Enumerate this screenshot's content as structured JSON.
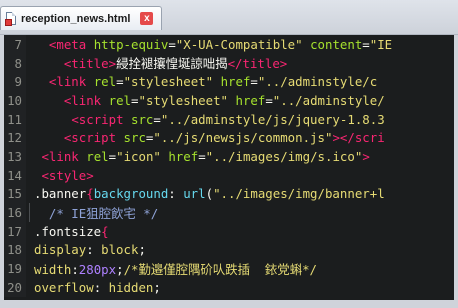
{
  "tab": {
    "filename": "reception_news.html",
    "close_symbol": "x"
  },
  "lines": [
    {
      "n": "7",
      "segments": [
        {
          "cls": "txt",
          "t": "  "
        },
        {
          "cls": "tag",
          "t": "<meta"
        },
        {
          "cls": "txt",
          "t": " "
        },
        {
          "cls": "attr",
          "t": "http-equiv"
        },
        {
          "cls": "txt",
          "t": "="
        },
        {
          "cls": "str",
          "t": "\"X-UA-Compatible\""
        },
        {
          "cls": "txt",
          "t": " "
        },
        {
          "cls": "attr",
          "t": "content"
        },
        {
          "cls": "txt",
          "t": "="
        },
        {
          "cls": "str",
          "t": "\"IE"
        }
      ]
    },
    {
      "n": "8",
      "segments": [
        {
          "cls": "txt",
          "t": "    "
        },
        {
          "cls": "tag",
          "t": "<title>"
        },
        {
          "cls": "txt",
          "t": "綅拴褪攘惶埏諒咄揭"
        },
        {
          "cls": "tag",
          "t": "</title>"
        }
      ]
    },
    {
      "n": "9",
      "segments": [
        {
          "cls": "txt",
          "t": "  "
        },
        {
          "cls": "tag",
          "t": "<link"
        },
        {
          "cls": "txt",
          "t": " "
        },
        {
          "cls": "attr",
          "t": "rel"
        },
        {
          "cls": "txt",
          "t": "="
        },
        {
          "cls": "str",
          "t": "\"stylesheet\""
        },
        {
          "cls": "txt",
          "t": " "
        },
        {
          "cls": "attr",
          "t": "href"
        },
        {
          "cls": "txt",
          "t": "="
        },
        {
          "cls": "str",
          "t": "\"../adminstyle/c"
        }
      ]
    },
    {
      "n": "10",
      "segments": [
        {
          "cls": "txt",
          "t": "    "
        },
        {
          "cls": "tag",
          "t": "<link"
        },
        {
          "cls": "txt",
          "t": " "
        },
        {
          "cls": "attr",
          "t": "rel"
        },
        {
          "cls": "txt",
          "t": "="
        },
        {
          "cls": "str",
          "t": "\"stylesheet\""
        },
        {
          "cls": "txt",
          "t": " "
        },
        {
          "cls": "attr",
          "t": "href"
        },
        {
          "cls": "txt",
          "t": "="
        },
        {
          "cls": "str",
          "t": "\"../adminstyle/"
        }
      ]
    },
    {
      "n": "11",
      "segments": [
        {
          "cls": "txt",
          "t": "     "
        },
        {
          "cls": "tag",
          "t": "<script"
        },
        {
          "cls": "txt",
          "t": " "
        },
        {
          "cls": "attr",
          "t": "src"
        },
        {
          "cls": "txt",
          "t": "="
        },
        {
          "cls": "str",
          "t": "\"../adminstyle/js/jquery-1.8.3"
        }
      ]
    },
    {
      "n": "12",
      "segments": [
        {
          "cls": "txt",
          "t": "    "
        },
        {
          "cls": "tag",
          "t": "<script"
        },
        {
          "cls": "txt",
          "t": " "
        },
        {
          "cls": "attr",
          "t": "src"
        },
        {
          "cls": "txt",
          "t": "="
        },
        {
          "cls": "str",
          "t": "\"../js/newsjs/common.js\""
        },
        {
          "cls": "tag",
          "t": "></scri"
        }
      ]
    },
    {
      "n": "13",
      "segments": [
        {
          "cls": "txt",
          "t": " "
        },
        {
          "cls": "tag",
          "t": "<link"
        },
        {
          "cls": "txt",
          "t": " "
        },
        {
          "cls": "attr",
          "t": "rel"
        },
        {
          "cls": "txt",
          "t": "="
        },
        {
          "cls": "str",
          "t": "\"icon\""
        },
        {
          "cls": "txt",
          "t": " "
        },
        {
          "cls": "attr",
          "t": "href"
        },
        {
          "cls": "txt",
          "t": "="
        },
        {
          "cls": "str",
          "t": "\"../images/img/s.ico\""
        },
        {
          "cls": "tag",
          "t": ">"
        }
      ]
    },
    {
      "n": "14",
      "segments": [
        {
          "cls": "txt",
          "t": " "
        },
        {
          "cls": "tag",
          "t": "<style>"
        }
      ]
    },
    {
      "n": "15",
      "segments": [
        {
          "cls": "sel",
          "t": ".banner"
        },
        {
          "cls": "bracket",
          "t": "{"
        },
        {
          "cls": "kw",
          "t": "background"
        },
        {
          "cls": "txt",
          "t": ": "
        },
        {
          "cls": "kw",
          "t": "url"
        },
        {
          "cls": "txt",
          "t": "("
        },
        {
          "cls": "str",
          "t": "\"../images/img/banner+l"
        }
      ]
    },
    {
      "n": "16",
      "segments": [
        {
          "cls": "txt",
          "t": "  "
        },
        {
          "cls": "cmt",
          "t": "/* IE狙腔飲宅 */"
        }
      ]
    },
    {
      "n": "17",
      "segments": [
        {
          "cls": "sel",
          "t": ".fontsize"
        },
        {
          "cls": "bracket",
          "t": "{"
        }
      ]
    },
    {
      "n": "18",
      "segments": [
        {
          "cls": "str",
          "t": "display"
        },
        {
          "cls": "txt",
          "t": ": "
        },
        {
          "cls": "str",
          "t": "block"
        },
        {
          "cls": "txt",
          "t": ";"
        }
      ]
    },
    {
      "n": "19",
      "segments": [
        {
          "cls": "str",
          "t": "width"
        },
        {
          "cls": "txt",
          "t": ":"
        },
        {
          "cls": "num",
          "t": "280px"
        },
        {
          "cls": "txt",
          "t": ";"
        },
        {
          "cls": "str",
          "t": "/*勤邉僅腔隅砎㕥跌插  銥党蝌*/"
        }
      ]
    },
    {
      "n": "20",
      "segments": [
        {
          "cls": "str",
          "t": "overflow"
        },
        {
          "cls": "txt",
          "t": ": "
        },
        {
          "cls": "str",
          "t": "hidden"
        },
        {
          "cls": "txt",
          "t": ";"
        }
      ]
    }
  ]
}
